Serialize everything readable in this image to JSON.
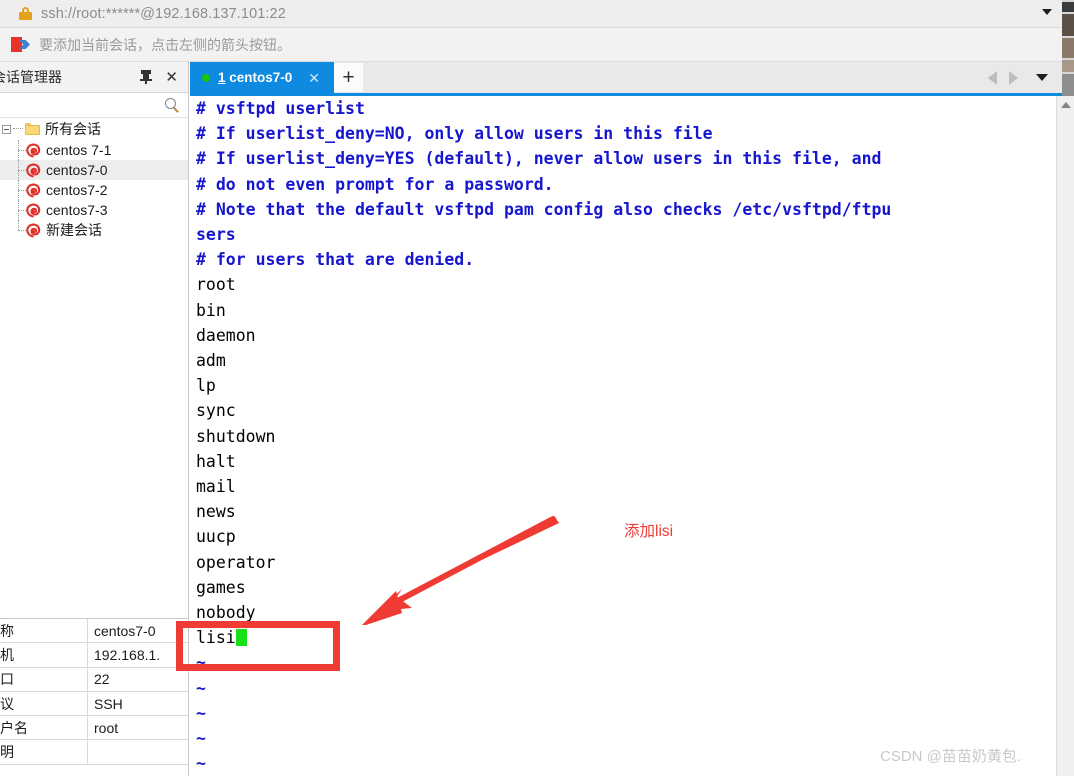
{
  "urlbar": {
    "address": "ssh://root:******@192.168.137.101:22",
    "lock_icon": "lock-icon",
    "dropdown_icon": "chevron-down-icon"
  },
  "notice": {
    "icon": "flag-arrow-icon",
    "text": "要添加当前会话，点击左侧的箭头按钮。"
  },
  "session_manager": {
    "title": "会话管理器",
    "pin_icon": "pin-icon",
    "close_icon": "close-icon",
    "search_icon": "search-icon",
    "search_placeholder": "",
    "tree": {
      "root_label": "所有会话",
      "items": [
        {
          "label": "centos 7-1",
          "selected": false
        },
        {
          "label": "centos7-0",
          "selected": true
        },
        {
          "label": "centos7-2",
          "selected": false
        },
        {
          "label": "centos7-3",
          "selected": false
        },
        {
          "label": "新建会话",
          "selected": false
        }
      ]
    },
    "properties": [
      {
        "key": "名称",
        "value": "centos7-0"
      },
      {
        "key": "主机",
        "value": "192.168.1."
      },
      {
        "key": "端口",
        "value": "22"
      },
      {
        "key": "协议",
        "value": "SSH"
      },
      {
        "key": "用户名",
        "value": "root"
      },
      {
        "key": "说明",
        "value": ""
      }
    ]
  },
  "tabbar": {
    "tabs": [
      {
        "number": "1",
        "label": " centos7-0",
        "status_dot": "#16c60c",
        "close_icon": "close-icon",
        "active": true
      }
    ],
    "new_tab_label": "+",
    "nav_prev_icon": "arrow-left-icon",
    "nav_next_icon": "arrow-right-icon",
    "tab_list_icon": "chevron-down-icon",
    "accent_color": "#0e8ae0"
  },
  "terminal": {
    "scroll_up_icon": "scroll-up-arrow-icon",
    "cursor_color": "#18e018",
    "comment_color": "#1616cf",
    "lines": [
      {
        "text": "# vsftpd userlist",
        "type": "comment"
      },
      {
        "text": "# If userlist_deny=NO, only allow users in this file",
        "type": "comment"
      },
      {
        "text": "# If userlist_deny=YES (default), never allow users in this file, and",
        "type": "comment"
      },
      {
        "text": "# do not even prompt for a password.",
        "type": "comment"
      },
      {
        "text": "# Note that the default vsftpd pam config also checks /etc/vsftpd/ftpu",
        "type": "comment"
      },
      {
        "text": "sers",
        "type": "comment"
      },
      {
        "text": "# for users that are denied.",
        "type": "comment"
      },
      {
        "text": "root",
        "type": "user"
      },
      {
        "text": "bin",
        "type": "user"
      },
      {
        "text": "daemon",
        "type": "user"
      },
      {
        "text": "adm",
        "type": "user"
      },
      {
        "text": "lp",
        "type": "user"
      },
      {
        "text": "sync",
        "type": "user"
      },
      {
        "text": "shutdown",
        "type": "user"
      },
      {
        "text": "halt",
        "type": "user"
      },
      {
        "text": "mail",
        "type": "user"
      },
      {
        "text": "news",
        "type": "user"
      },
      {
        "text": "uucp",
        "type": "user"
      },
      {
        "text": "operator",
        "type": "user"
      },
      {
        "text": "games",
        "type": "user"
      },
      {
        "text": "nobody",
        "type": "user"
      },
      {
        "text": "lisi",
        "type": "cursor"
      },
      {
        "text": "~",
        "type": "tilde"
      },
      {
        "text": "~",
        "type": "tilde"
      },
      {
        "text": "~",
        "type": "tilde"
      },
      {
        "text": "~",
        "type": "tilde"
      },
      {
        "text": "~",
        "type": "tilde"
      }
    ]
  },
  "annotations": {
    "callout_text": "添加lisi",
    "callout_color": "#ef3b33",
    "highlight_box_color": "#ef3b33"
  },
  "watermark": {
    "text": "CSDN @苗苗奶黄包."
  }
}
